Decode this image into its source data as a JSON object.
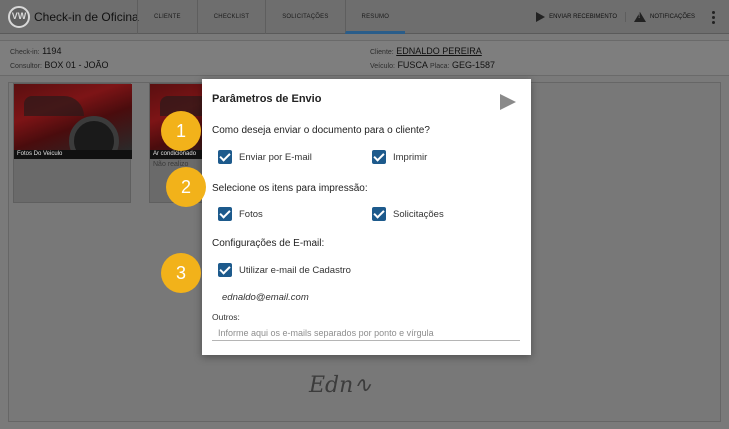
{
  "app": {
    "title": "Check-in de Oficina"
  },
  "nav": {
    "tabs": [
      {
        "label": "CLIENTE"
      },
      {
        "label": "CHECKLIST"
      },
      {
        "label": "SOLICITAÇÕES"
      },
      {
        "label": "RESUMO"
      }
    ]
  },
  "actions": {
    "send_label": "ENVIAR RECEBIMENTO",
    "notifications_label": "NOTIFICAÇÕES"
  },
  "info": {
    "checkin_label": "Check-in:",
    "checkin_value": "1194",
    "consultor_label": "Consultor:",
    "consultor_value": "BOX 01 - JOÃO",
    "cliente_label": "Cliente:",
    "cliente_value": "EDNALDO PEREIRA",
    "veiculo_label": "Veículo:",
    "veiculo_value": "FUSCA",
    "placa_label": "Placa:",
    "placa_value": "GEG-1587"
  },
  "cards": [
    {
      "caption": "Fotos Do Veiculo",
      "subtitle": ""
    },
    {
      "caption": "Ar condicionado",
      "subtitle": "Não realizo"
    }
  ],
  "modal": {
    "title": "Parâmetros de Envio",
    "q1": "Como deseja enviar o documento para o cliente?",
    "opt_email": "Enviar por E-mail",
    "opt_print": "Imprimir",
    "q2": "Selecione os itens para impressão:",
    "opt_photos": "Fotos",
    "opt_requests": "Solicitações",
    "q3": "Configurações de E-mail:",
    "opt_use_email": "Utilizar e-mail de Cadastro",
    "email": "ednaldo@email.com",
    "outros_label": "Outros:",
    "outros_placeholder": "Informe aqui os e-mails separados por ponto e vírgula"
  },
  "steps": [
    "1",
    "2",
    "3"
  ],
  "colors": {
    "accent": "#1d5a8c",
    "step_badge": "#f2b21a"
  }
}
